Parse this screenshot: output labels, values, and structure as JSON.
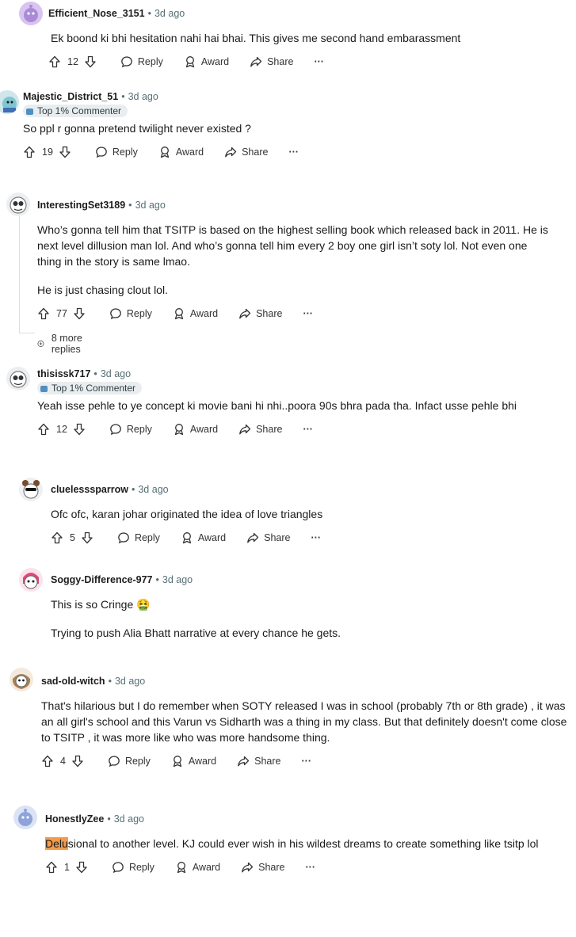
{
  "comments": [
    {
      "user": "Efficient_Nose_3151",
      "time": "3d ago",
      "body": [
        "Ek boond ki bhi hesitation nahi hai bhai. This gives me second hand embarassment"
      ],
      "votes": "12"
    },
    {
      "user": "Majestic_District_51",
      "time": "3d ago",
      "flair": "Top 1% Commenter",
      "body": [
        "So ppl r gonna pretend twilight never existed ?"
      ],
      "votes": "19"
    },
    {
      "user": "InterestingSet3189",
      "time": "3d ago",
      "body": [
        "Who’s gonna tell him that TSITP is based on the highest selling book which released back in 2011. He is next level dillusion man lol. And who’s gonna tell him every 2 boy one girl isn’t soty lol. Not even one thing in the story is same lmao.",
        "He is just chasing clout lol."
      ],
      "votes": "77",
      "more_replies": "8 more replies"
    },
    {
      "user": "thisissk717",
      "time": "3d ago",
      "flair": "Top 1% Commenter",
      "body": [
        "Yeah isse pehle to ye concept ki movie bani hi nhi..poora 90s bhra pada tha. Infact usse pehle bhi"
      ],
      "votes": "12"
    },
    {
      "user": "cluelesssparrow",
      "time": "3d ago",
      "body": [
        "Ofc ofc, karan johar originated the idea of love triangles"
      ],
      "votes": "5"
    },
    {
      "user": "Soggy-Difference-977",
      "time": "3d ago",
      "body": [
        "This is so Cringe 🤮",
        "Trying to push Alia Bhatt narrative at every chance he gets."
      ]
    },
    {
      "user": "sad-old-witch",
      "time": "3d ago",
      "body": [
        "That's hilarious but I do remember when SOTY released I was in school (probably 7th or 8th grade) , it was an all girl's school and this Varun vs Sidharth was a thing in my class. But that definitely doesn't come close to TSITP , it was more like who was more handsome thing."
      ],
      "votes": "4"
    },
    {
      "user": "HonestlyZee",
      "time": "3d ago",
      "highlight": "Delu",
      "body_rest": "sional to another level. KJ could ever wish in his wildest dreams to create something like tsitp lol",
      "votes": "1"
    }
  ],
  "labels": {
    "reply": "Reply",
    "award": "Award",
    "share": "Share",
    "more": "···"
  },
  "colors": {
    "highlight": "#f29b4c",
    "thread_line": "#dcdfe1",
    "flair_bg": "#eaedef"
  }
}
